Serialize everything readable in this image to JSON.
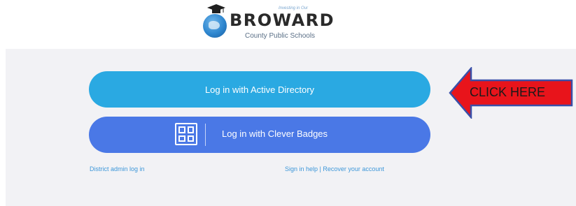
{
  "logo": {
    "tagline": "Investing in Our",
    "wordmark": "BROWARD",
    "subtitle": "County Public Schools",
    "icon": "graduation-cap-globe-icon"
  },
  "login": {
    "active_directory_label": "Log in with Active Directory",
    "clever_badges_label": "Log in with Clever Badges",
    "clever_badges_icon": "qr-badge-icon",
    "district_admin_link": "District admin log in",
    "help_link": "Sign in help | Recover your account"
  },
  "annotation": {
    "text": "CLICK HERE",
    "arrow_color": "#e8141b",
    "arrow_border_color": "#3a4fa8"
  },
  "colors": {
    "active_directory_button": "#2aa9e2",
    "clever_badges_button": "#4a78e6",
    "link": "#3d97d9",
    "panel_background": "#f2f2f5"
  }
}
